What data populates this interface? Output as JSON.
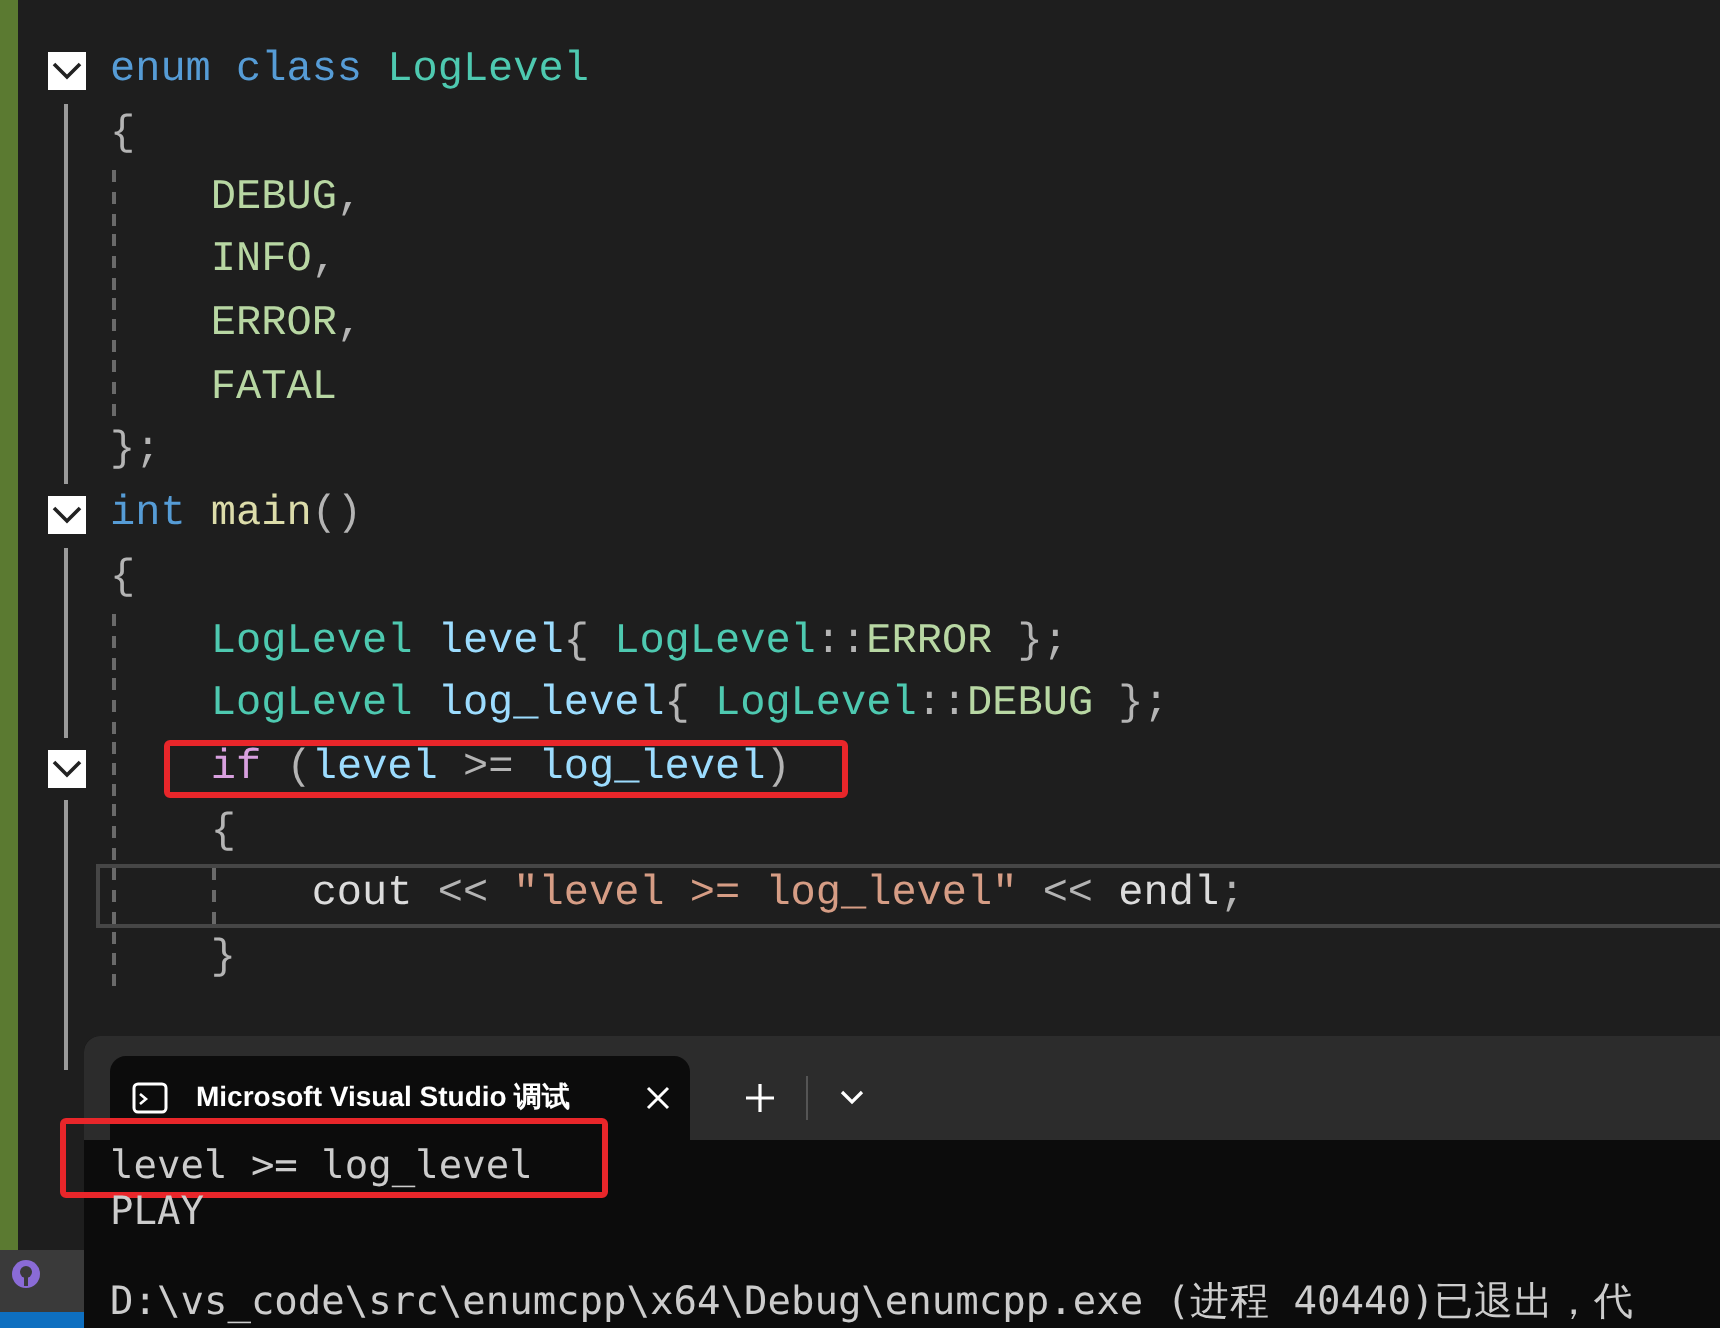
{
  "editor": {
    "lines": [
      {
        "fold": true,
        "current": false,
        "highlighted": false,
        "tokens": [
          {
            "text": "enum",
            "kind": "keyword"
          },
          {
            "text": " class ",
            "kind": "keyword"
          },
          {
            "text": "LogLevel",
            "kind": "type"
          }
        ]
      },
      {
        "fold": false,
        "current": false,
        "highlighted": false,
        "tokens": [
          {
            "text": "{",
            "kind": "punct"
          }
        ]
      },
      {
        "fold": false,
        "current": false,
        "highlighted": false,
        "tokens": [
          {
            "text": "    DEBUG",
            "kind": "enumconst"
          },
          {
            "text": ",",
            "kind": "punct"
          }
        ]
      },
      {
        "fold": false,
        "current": false,
        "highlighted": false,
        "tokens": [
          {
            "text": "    INFO",
            "kind": "enumconst"
          },
          {
            "text": ",",
            "kind": "punct"
          }
        ]
      },
      {
        "fold": false,
        "current": false,
        "highlighted": false,
        "tokens": [
          {
            "text": "    ERROR",
            "kind": "enumconst"
          },
          {
            "text": ",",
            "kind": "punct"
          }
        ]
      },
      {
        "fold": false,
        "current": false,
        "highlighted": false,
        "tokens": [
          {
            "text": "    FATAL",
            "kind": "enumconst"
          }
        ]
      },
      {
        "fold": false,
        "current": false,
        "highlighted": false,
        "tokens": [
          {
            "text": "};",
            "kind": "punct"
          }
        ]
      },
      {
        "fold": true,
        "current": false,
        "highlighted": false,
        "tokens": [
          {
            "text": "int",
            "kind": "keyword"
          },
          {
            "text": " main",
            "kind": "func"
          },
          {
            "text": "()",
            "kind": "punct"
          }
        ]
      },
      {
        "fold": false,
        "current": false,
        "highlighted": false,
        "tokens": [
          {
            "text": "{",
            "kind": "punct"
          }
        ]
      },
      {
        "fold": false,
        "current": false,
        "highlighted": false,
        "tokens": [
          {
            "text": "    LogLevel",
            "kind": "type"
          },
          {
            "text": " level",
            "kind": "var"
          },
          {
            "text": "{ ",
            "kind": "punct"
          },
          {
            "text": "LogLevel",
            "kind": "type"
          },
          {
            "text": "::",
            "kind": "punct"
          },
          {
            "text": "ERROR",
            "kind": "enumconst"
          },
          {
            "text": " };",
            "kind": "punct"
          }
        ]
      },
      {
        "fold": false,
        "current": false,
        "highlighted": false,
        "tokens": [
          {
            "text": "    LogLevel",
            "kind": "type"
          },
          {
            "text": " log_level",
            "kind": "var"
          },
          {
            "text": "{ ",
            "kind": "punct"
          },
          {
            "text": "LogLevel",
            "kind": "type"
          },
          {
            "text": "::",
            "kind": "punct"
          },
          {
            "text": "DEBUG",
            "kind": "enumconst"
          },
          {
            "text": " };",
            "kind": "punct"
          }
        ]
      },
      {
        "fold": true,
        "current": false,
        "highlighted": true,
        "tokens": [
          {
            "text": "    if",
            "kind": "control"
          },
          {
            "text": " (",
            "kind": "punct"
          },
          {
            "text": "level",
            "kind": "var"
          },
          {
            "text": " >= ",
            "kind": "punct"
          },
          {
            "text": "log_level",
            "kind": "var"
          },
          {
            "text": ")",
            "kind": "punct"
          }
        ]
      },
      {
        "fold": false,
        "current": false,
        "highlighted": false,
        "tokens": [
          {
            "text": "    {",
            "kind": "punct"
          }
        ]
      },
      {
        "fold": false,
        "current": true,
        "highlighted": false,
        "tokens": [
          {
            "text": "        cout",
            "kind": "plain"
          },
          {
            "text": " << ",
            "kind": "punct"
          },
          {
            "text": "\"level >= log_level\"",
            "kind": "string"
          },
          {
            "text": " << ",
            "kind": "punct"
          },
          {
            "text": "endl",
            "kind": "plain"
          },
          {
            "text": ";",
            "kind": "punct"
          }
        ]
      },
      {
        "fold": false,
        "current": false,
        "highlighted": false,
        "tokens": [
          {
            "text": "    }",
            "kind": "punct"
          }
        ]
      }
    ]
  },
  "terminal": {
    "tabs": [
      {
        "title": "Microsoft Visual Studio 调试",
        "selected": true
      }
    ],
    "output": [
      {
        "text": "level >= log_level",
        "highlighted": true,
        "gap_before": false
      },
      {
        "text": "PLAY",
        "highlighted": false,
        "gap_before": false
      },
      {
        "text": "D:\\vs_code\\src\\enumcpp\\x64\\Debug\\enumcpp.exe (进程 40440)已退出，代",
        "highlighted": false,
        "gap_before": true
      }
    ]
  }
}
